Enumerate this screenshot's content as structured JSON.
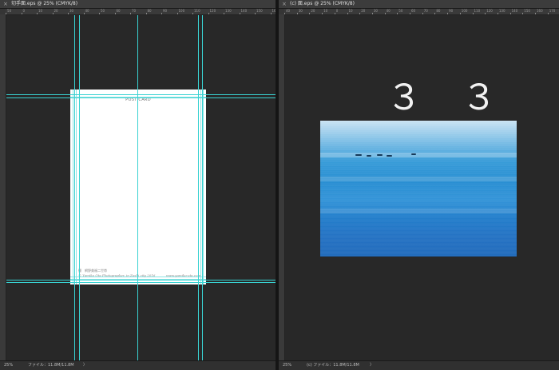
{
  "left_doc": {
    "tab_title": "切手面.eps @ 25% (CMYK/8)",
    "close_glyph": "×",
    "ruler_top_labels": [
      "50",
      "0",
      "10",
      "20",
      "30",
      "40",
      "50",
      "60",
      "70",
      "80",
      "90",
      "100",
      "110",
      "120",
      "130",
      "140",
      "150",
      "160"
    ],
    "status_zoom": "25%",
    "status_file": "ファイル：11.8M/11.8M",
    "status_arrow": "〉",
    "postcard": {
      "title": "POST CARD",
      "credit_line1": "撮　網野美福二世帯",
      "credit_line2": "© Yumiko Ota Photographer, in Zushi city 2016",
      "credit_url": "www.yumiko-ota.com"
    }
  },
  "right_doc": {
    "tab_title": "(c) 面.eps @ 25% (CMYK/8)",
    "close_glyph": "×",
    "ruler_top_labels": [
      "40",
      "30",
      "20",
      "10",
      "0",
      "10",
      "20",
      "30",
      "40",
      "50",
      "60",
      "70",
      "80",
      "90",
      "100",
      "110",
      "120",
      "130",
      "140",
      "150",
      "160",
      "170"
    ],
    "big_number": "３ ３",
    "status_zoom": "25%",
    "status_file": "(c) ファイル：11.8M/11.8M",
    "status_arrow": "〉"
  },
  "colors": {
    "guide": "#39d2d2",
    "canvas_bg": "#282828",
    "sea_top": "#c8e2f3",
    "sea_bottom": "#1664b8"
  }
}
